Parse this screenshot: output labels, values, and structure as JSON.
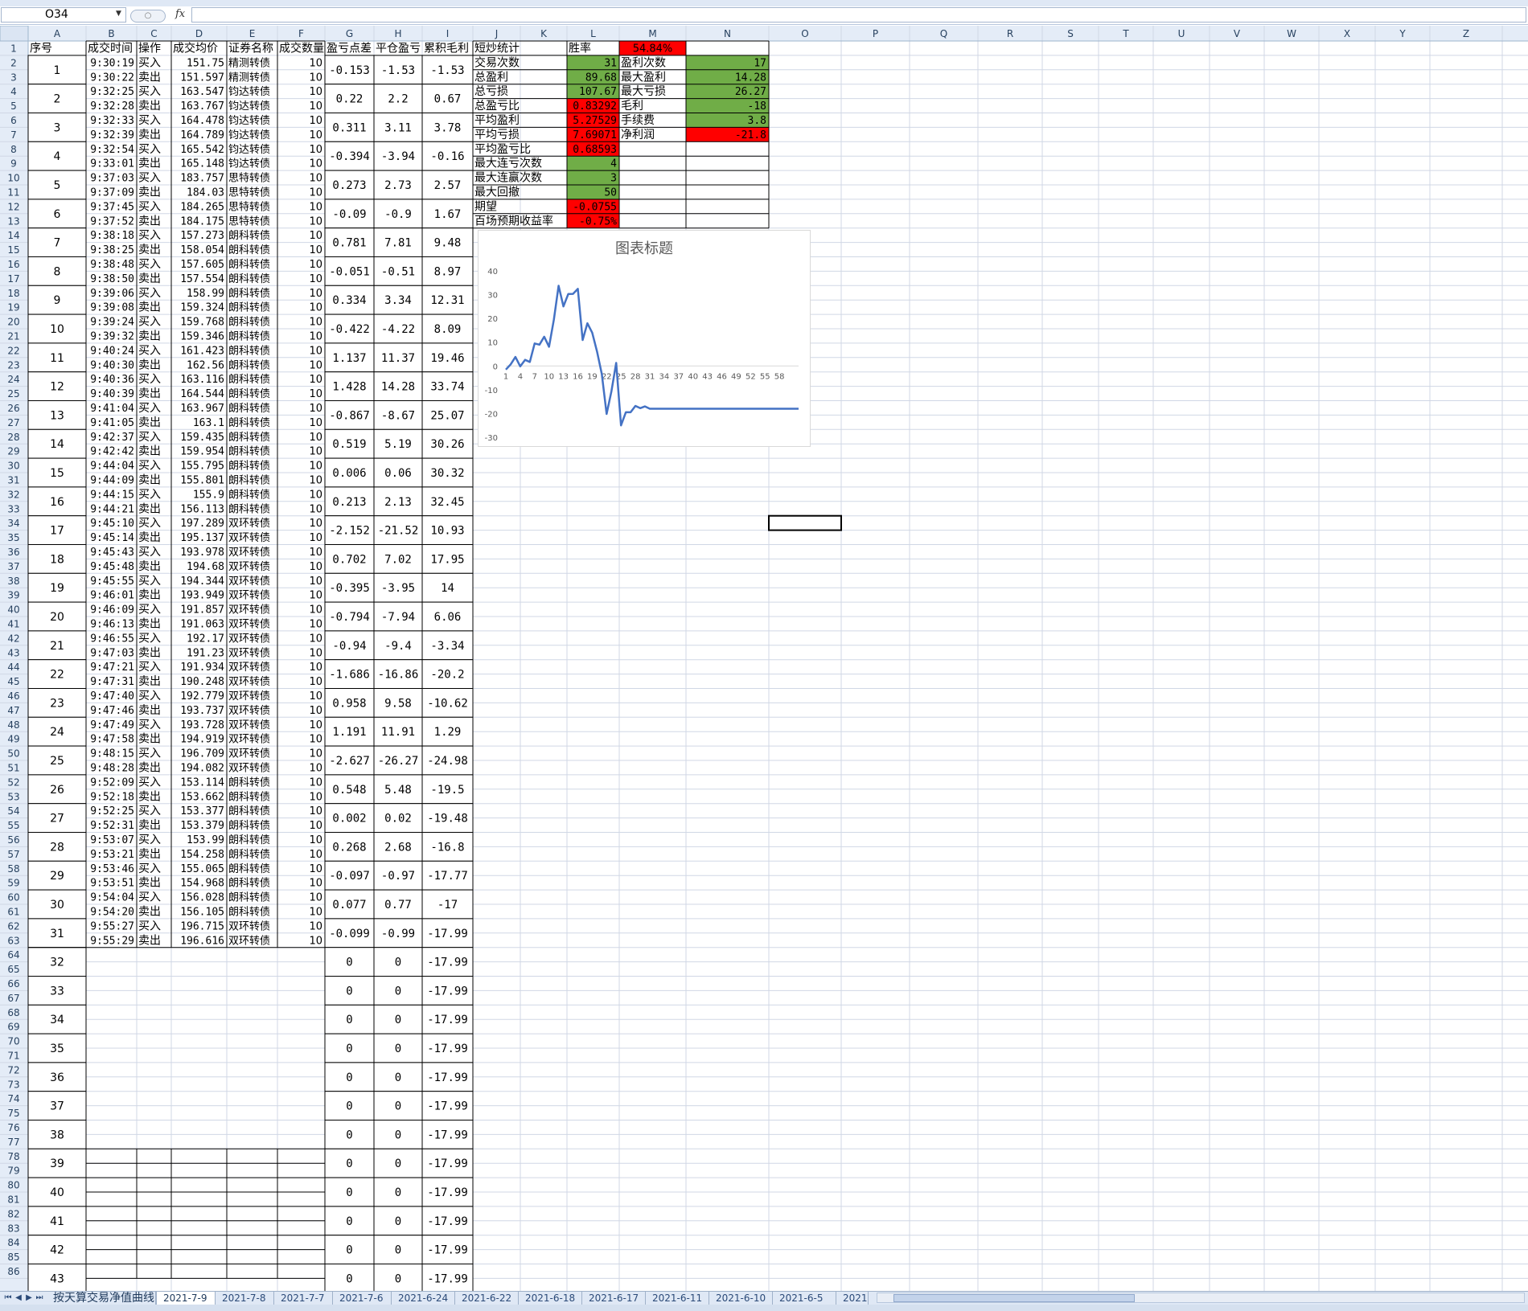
{
  "name_box": "O34",
  "fx_label": "fx",
  "columns": [
    "A",
    "B",
    "C",
    "D",
    "E",
    "F",
    "G",
    "H",
    "I",
    "J",
    "K",
    "L",
    "M",
    "N",
    "O",
    "P",
    "Q",
    "R",
    "S",
    "T",
    "U",
    "V",
    "W",
    "X",
    "Y",
    "Z"
  ],
  "headers": [
    "序号",
    "成交时间",
    "操作",
    "成交均价",
    "证券名称",
    "成交数量",
    "盈亏点差",
    "平仓盈亏",
    "累积毛利"
  ],
  "trades": [
    [
      1,
      "9:30:19",
      "买入",
      "151.75",
      "精测转债"
    ],
    [
      1,
      "9:30:22",
      "卖出",
      "151.597",
      "精测转债"
    ],
    [
      2,
      "9:32:25",
      "买入",
      "163.547",
      "钧达转债"
    ],
    [
      2,
      "9:32:28",
      "卖出",
      "163.767",
      "钧达转债"
    ],
    [
      3,
      "9:32:33",
      "买入",
      "164.478",
      "钧达转债"
    ],
    [
      3,
      "9:32:39",
      "卖出",
      "164.789",
      "钧达转债"
    ],
    [
      4,
      "9:32:54",
      "买入",
      "165.542",
      "钧达转债"
    ],
    [
      4,
      "9:33:01",
      "卖出",
      "165.148",
      "钧达转债"
    ],
    [
      5,
      "9:37:03",
      "买入",
      "183.757",
      "思特转债"
    ],
    [
      5,
      "9:37:09",
      "卖出",
      "184.03",
      "思特转债"
    ],
    [
      6,
      "9:37:45",
      "买入",
      "184.265",
      "思特转债"
    ],
    [
      6,
      "9:37:52",
      "卖出",
      "184.175",
      "思特转债"
    ],
    [
      7,
      "9:38:18",
      "买入",
      "157.273",
      "朗科转债"
    ],
    [
      7,
      "9:38:25",
      "卖出",
      "158.054",
      "朗科转债"
    ],
    [
      8,
      "9:38:48",
      "买入",
      "157.605",
      "朗科转债"
    ],
    [
      8,
      "9:38:50",
      "卖出",
      "157.554",
      "朗科转债"
    ],
    [
      9,
      "9:39:06",
      "买入",
      "158.99",
      "朗科转债"
    ],
    [
      9,
      "9:39:08",
      "卖出",
      "159.324",
      "朗科转债"
    ],
    [
      10,
      "9:39:24",
      "买入",
      "159.768",
      "朗科转债"
    ],
    [
      10,
      "9:39:32",
      "卖出",
      "159.346",
      "朗科转债"
    ],
    [
      11,
      "9:40:24",
      "买入",
      "161.423",
      "朗科转债"
    ],
    [
      11,
      "9:40:30",
      "卖出",
      "162.56",
      "朗科转债"
    ],
    [
      12,
      "9:40:36",
      "买入",
      "163.116",
      "朗科转债"
    ],
    [
      12,
      "9:40:39",
      "卖出",
      "164.544",
      "朗科转债"
    ],
    [
      13,
      "9:41:04",
      "买入",
      "163.967",
      "朗科转债"
    ],
    [
      13,
      "9:41:05",
      "卖出",
      "163.1",
      "朗科转债"
    ],
    [
      14,
      "9:42:37",
      "买入",
      "159.435",
      "朗科转债"
    ],
    [
      14,
      "9:42:42",
      "卖出",
      "159.954",
      "朗科转债"
    ],
    [
      15,
      "9:44:04",
      "买入",
      "155.795",
      "朗科转债"
    ],
    [
      15,
      "9:44:09",
      "卖出",
      "155.801",
      "朗科转债"
    ],
    [
      16,
      "9:44:15",
      "买入",
      "155.9",
      "朗科转债"
    ],
    [
      16,
      "9:44:21",
      "卖出",
      "156.113",
      "朗科转债"
    ],
    [
      17,
      "9:45:10",
      "买入",
      "197.289",
      "双环转债"
    ],
    [
      17,
      "9:45:14",
      "卖出",
      "195.137",
      "双环转债"
    ],
    [
      18,
      "9:45:43",
      "买入",
      "193.978",
      "双环转债"
    ],
    [
      18,
      "9:45:48",
      "卖出",
      "194.68",
      "双环转债"
    ],
    [
      19,
      "9:45:55",
      "买入",
      "194.344",
      "双环转债"
    ],
    [
      19,
      "9:46:01",
      "卖出",
      "193.949",
      "双环转债"
    ],
    [
      20,
      "9:46:09",
      "买入",
      "191.857",
      "双环转债"
    ],
    [
      20,
      "9:46:13",
      "卖出",
      "191.063",
      "双环转债"
    ],
    [
      21,
      "9:46:55",
      "买入",
      "192.17",
      "双环转债"
    ],
    [
      21,
      "9:47:03",
      "卖出",
      "191.23",
      "双环转债"
    ],
    [
      22,
      "9:47:21",
      "买入",
      "191.934",
      "双环转债"
    ],
    [
      22,
      "9:47:31",
      "卖出",
      "190.248",
      "双环转债"
    ],
    [
      23,
      "9:47:40",
      "买入",
      "192.779",
      "双环转债"
    ],
    [
      23,
      "9:47:46",
      "卖出",
      "193.737",
      "双环转债"
    ],
    [
      24,
      "9:47:49",
      "买入",
      "193.728",
      "双环转债"
    ],
    [
      24,
      "9:47:58",
      "卖出",
      "194.919",
      "双环转债"
    ],
    [
      25,
      "9:48:15",
      "买入",
      "196.709",
      "双环转债"
    ],
    [
      25,
      "9:48:28",
      "卖出",
      "194.082",
      "双环转债"
    ],
    [
      26,
      "9:52:09",
      "买入",
      "153.114",
      "朗科转债"
    ],
    [
      26,
      "9:52:18",
      "卖出",
      "153.662",
      "朗科转债"
    ],
    [
      27,
      "9:52:25",
      "买入",
      "153.377",
      "朗科转债"
    ],
    [
      27,
      "9:52:31",
      "卖出",
      "153.379",
      "朗科转债"
    ],
    [
      28,
      "9:53:07",
      "买入",
      "153.99",
      "朗科转债"
    ],
    [
      28,
      "9:53:21",
      "卖出",
      "154.258",
      "朗科转债"
    ],
    [
      29,
      "9:53:46",
      "买入",
      "155.065",
      "朗科转债"
    ],
    [
      29,
      "9:53:51",
      "卖出",
      "154.968",
      "朗科转债"
    ],
    [
      30,
      "9:54:04",
      "买入",
      "156.028",
      "朗科转债"
    ],
    [
      30,
      "9:54:20",
      "卖出",
      "156.105",
      "朗科转债"
    ],
    [
      31,
      "9:55:27",
      "买入",
      "196.715",
      "双环转债"
    ],
    [
      31,
      "9:55:29",
      "卖出",
      "196.616",
      "双环转债"
    ]
  ],
  "qty": "10",
  "pnl": [
    [
      "-0.153",
      "-1.53",
      "-1.53"
    ],
    [
      "0.22",
      "2.2",
      "0.67"
    ],
    [
      "0.311",
      "3.11",
      "3.78"
    ],
    [
      "-0.394",
      "-3.94",
      "-0.16"
    ],
    [
      "0.273",
      "2.73",
      "2.57"
    ],
    [
      "-0.09",
      "-0.9",
      "1.67"
    ],
    [
      "0.781",
      "7.81",
      "9.48"
    ],
    [
      "-0.051",
      "-0.51",
      "8.97"
    ],
    [
      "0.334",
      "3.34",
      "12.31"
    ],
    [
      "-0.422",
      "-4.22",
      "8.09"
    ],
    [
      "1.137",
      "11.37",
      "19.46"
    ],
    [
      "1.428",
      "14.28",
      "33.74"
    ],
    [
      "-0.867",
      "-8.67",
      "25.07"
    ],
    [
      "0.519",
      "5.19",
      "30.26"
    ],
    [
      "0.006",
      "0.06",
      "30.32"
    ],
    [
      "0.213",
      "2.13",
      "32.45"
    ],
    [
      "-2.152",
      "-21.52",
      "10.93"
    ],
    [
      "0.702",
      "7.02",
      "17.95"
    ],
    [
      "-0.395",
      "-3.95",
      "14"
    ],
    [
      "-0.794",
      "-7.94",
      "6.06"
    ],
    [
      "-0.94",
      "-9.4",
      "-3.34"
    ],
    [
      "-1.686",
      "-16.86",
      "-20.2"
    ],
    [
      "0.958",
      "9.58",
      "-10.62"
    ],
    [
      "1.191",
      "11.91",
      "1.29"
    ],
    [
      "-2.627",
      "-26.27",
      "-24.98"
    ],
    [
      "0.548",
      "5.48",
      "-19.5"
    ],
    [
      "0.002",
      "0.02",
      "-19.48"
    ],
    [
      "0.268",
      "2.68",
      "-16.8"
    ],
    [
      "-0.097",
      "-0.97",
      "-17.77"
    ],
    [
      "0.077",
      "0.77",
      "-17"
    ],
    [
      "-0.099",
      "-0.99",
      "-17.99"
    ],
    [
      "0",
      "0",
      "-17.99"
    ],
    [
      "0",
      "0",
      "-17.99"
    ],
    [
      "0",
      "0",
      "-17.99"
    ],
    [
      "0",
      "0",
      "-17.99"
    ],
    [
      "0",
      "0",
      "-17.99"
    ],
    [
      "0",
      "0",
      "-17.99"
    ],
    [
      "0",
      "0",
      "-17.99"
    ],
    [
      "0",
      "0",
      "-17.99"
    ],
    [
      "0",
      "0",
      "-17.99"
    ],
    [
      "0",
      "0",
      "-17.99"
    ],
    [
      "0",
      "0",
      "-17.99"
    ],
    [
      "0",
      "0",
      "-17.99"
    ]
  ],
  "stats_title": "短炒统计",
  "win_rate": {
    "label": "胜率",
    "value": "54.84%"
  },
  "stats_left": [
    {
      "label": "交易次数",
      "value": "31",
      "color": "green"
    },
    {
      "label": "总盈利",
      "value": "89.68",
      "color": "green"
    },
    {
      "label": "总亏损",
      "value": "107.67",
      "color": "green"
    },
    {
      "label": "总盈亏比",
      "value": "0.83292",
      "color": "red"
    },
    {
      "label": "平均盈利",
      "value": "5.27529",
      "color": "red"
    },
    {
      "label": "平均亏损",
      "value": "7.69071",
      "color": "red"
    },
    {
      "label": "平均盈亏比",
      "value": "0.68593",
      "color": "red"
    },
    {
      "label": "最大连亏次数",
      "value": "4",
      "color": "green"
    },
    {
      "label": "最大连赢次数",
      "value": "3",
      "color": "green"
    },
    {
      "label": "最大回撤",
      "value": "50",
      "color": "green"
    },
    {
      "label": "期望",
      "value": "-0.0755",
      "color": "red"
    },
    {
      "label": "百场预期收益率",
      "value": "-0.75%",
      "color": "red"
    }
  ],
  "stats_right": [
    {
      "label": "盈利次数",
      "value": "17",
      "color": "green"
    },
    {
      "label": "最大盈利",
      "value": "14.28",
      "color": "green"
    },
    {
      "label": "最大亏损",
      "value": "26.27",
      "color": "green"
    },
    {
      "label": "毛利",
      "value": "-18",
      "color": "green"
    },
    {
      "label": "手续费",
      "value": "3.8",
      "color": "green"
    },
    {
      "label": "净利润",
      "value": "-21.8",
      "color": "red"
    }
  ],
  "colors": {
    "green": "#70ad47",
    "red": "#ff0000",
    "grid": "#d0d7e5",
    "header_bg": "#e4ecf7",
    "line": "#4472c4"
  },
  "chart_data": {
    "type": "line",
    "title": "图表标题",
    "x_tick_labels": [
      "1",
      "4",
      "7",
      "10",
      "13",
      "16",
      "19",
      "22",
      "25",
      "28",
      "31",
      "34",
      "37",
      "40",
      "43",
      "46",
      "49",
      "52",
      "55",
      "58"
    ],
    "y_ticks": [
      40,
      30,
      20,
      10,
      0,
      -10,
      -20,
      -30
    ],
    "ylim": [
      -30,
      40
    ],
    "values": [
      -1.53,
      0.67,
      3.78,
      -0.16,
      2.57,
      1.67,
      9.48,
      8.97,
      12.31,
      8.09,
      19.46,
      33.74,
      25.07,
      30.26,
      30.32,
      32.45,
      10.93,
      17.95,
      14,
      6.06,
      -3.34,
      -20.2,
      -10.62,
      1.29,
      -24.98,
      -19.5,
      -19.48,
      -16.8,
      -17.77,
      -17,
      -17.99,
      -17.99,
      -17.99,
      -17.99,
      -17.99,
      -17.99,
      -17.99,
      -17.99,
      -17.99,
      -17.99,
      -17.99,
      -17.99,
      -17.99,
      -17.99,
      -17.99,
      -17.99,
      -17.99,
      -17.99,
      -17.99,
      -17.99,
      -17.99,
      -17.99,
      -17.99,
      -17.99,
      -17.99,
      -17.99,
      -17.99,
      -17.99,
      -17.99,
      -17.99,
      -17.99,
      -17.99
    ],
    "grid": false,
    "legend": "none"
  },
  "tabs": [
    "按天算交易净值曲线",
    "2021-7-9",
    "2021-7-8",
    "2021-7-7",
    "2021-7-6",
    "2021-6-24",
    "2021-6-22",
    "2021-6-18",
    "2021-6-17",
    "2021-6-11",
    "2021-6-10",
    "2021-6-5",
    "2021"
  ],
  "active_tab": 1,
  "tab_nav": [
    "⏮",
    "◀",
    "▶",
    "⏭"
  ]
}
